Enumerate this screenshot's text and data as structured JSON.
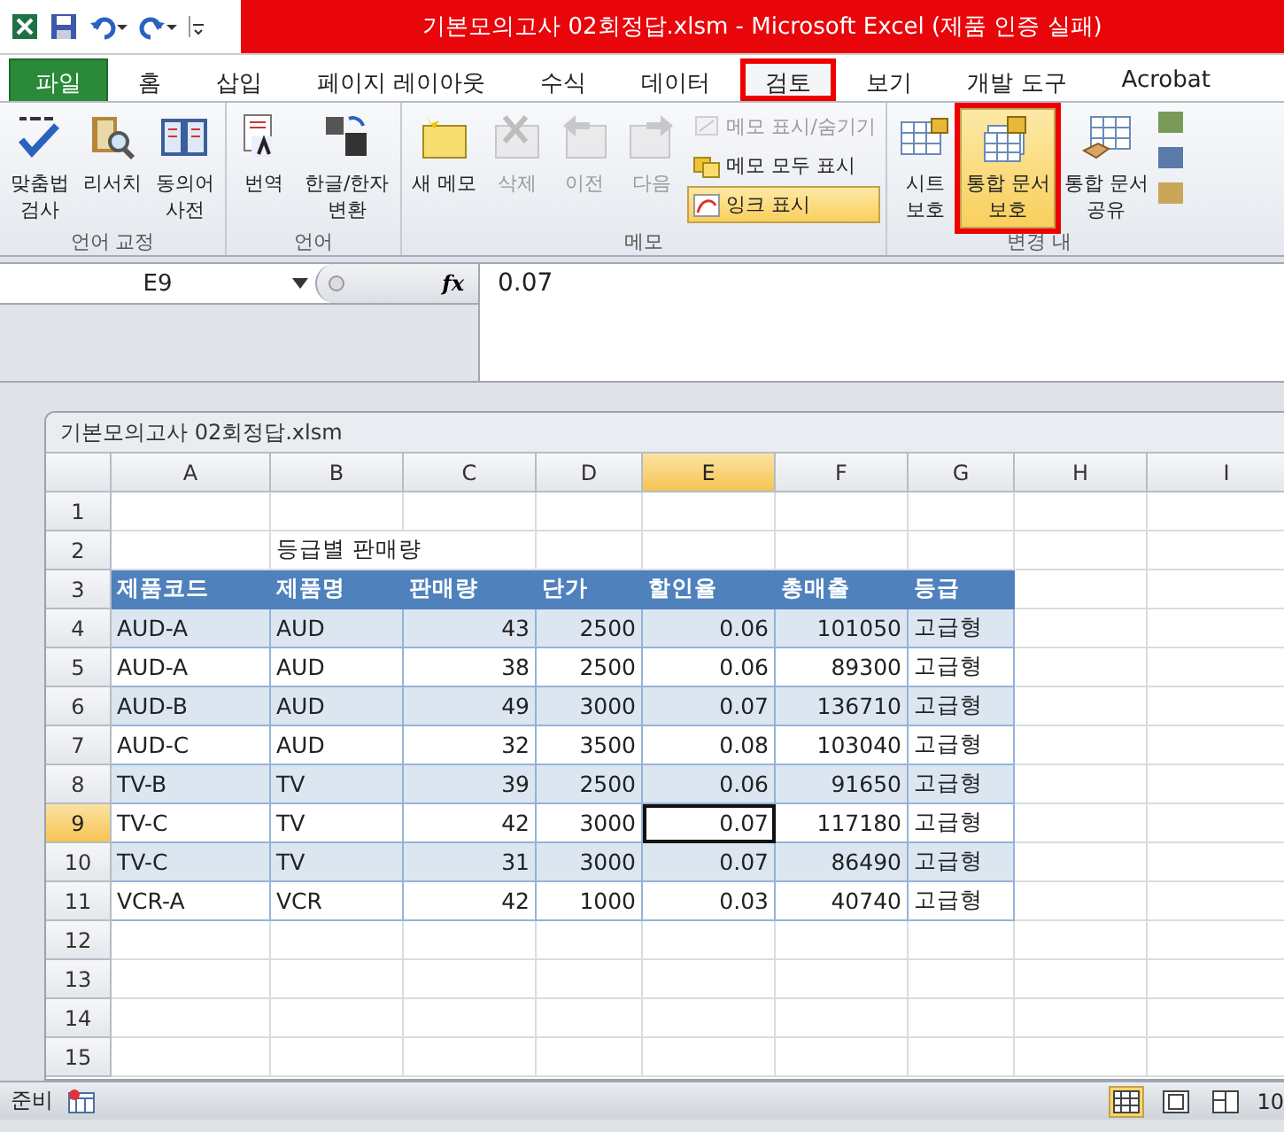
{
  "title_bar": {
    "title": "기본모의고사 02회정답.xlsm  -  Microsoft Excel (제품 인증 실패)"
  },
  "tabs": [
    {
      "label": "파일",
      "kind": "file",
      "selected": false,
      "marked": false
    },
    {
      "label": "홈",
      "kind": "tab",
      "selected": false,
      "marked": false
    },
    {
      "label": "삽입",
      "kind": "tab",
      "selected": false,
      "marked": false
    },
    {
      "label": "페이지 레이아웃",
      "kind": "tab",
      "selected": false,
      "marked": false
    },
    {
      "label": "수식",
      "kind": "tab",
      "selected": false,
      "marked": false
    },
    {
      "label": "데이터",
      "kind": "tab",
      "selected": false,
      "marked": false
    },
    {
      "label": "검토",
      "kind": "tab",
      "selected": true,
      "marked": true
    },
    {
      "label": "보기",
      "kind": "tab",
      "selected": false,
      "marked": false
    },
    {
      "label": "개발 도구",
      "kind": "tab",
      "selected": false,
      "marked": false
    },
    {
      "label": "Acrobat",
      "kind": "tab",
      "selected": false,
      "marked": false
    }
  ],
  "ribbon": {
    "groups": [
      {
        "label": "언어 교정",
        "buttons": [
          {
            "label": "맞춤법\n검사",
            "kind": "large",
            "disabled": false,
            "highlighted": false,
            "marked": false
          },
          {
            "label": "리서치",
            "kind": "large",
            "disabled": false,
            "highlighted": false,
            "marked": false
          },
          {
            "label": "동의어\n사전",
            "kind": "large",
            "disabled": false,
            "highlighted": false,
            "marked": false
          }
        ]
      },
      {
        "label": "언어",
        "buttons": [
          {
            "label": "번역",
            "kind": "large",
            "disabled": false,
            "highlighted": false,
            "marked": false
          },
          {
            "label": "한글/한자\n변환",
            "kind": "large",
            "disabled": false,
            "highlighted": false,
            "marked": false
          }
        ]
      },
      {
        "label": "메모",
        "buttons": [
          {
            "label": "새 메모",
            "kind": "large",
            "disabled": false,
            "highlighted": false,
            "marked": false
          },
          {
            "label": "삭제",
            "kind": "large",
            "disabled": true,
            "highlighted": false,
            "marked": false
          },
          {
            "label": "이전",
            "kind": "large",
            "disabled": true,
            "highlighted": false,
            "marked": false
          },
          {
            "label": "다음",
            "kind": "large",
            "disabled": true,
            "highlighted": false,
            "marked": false
          },
          {
            "label": "메모 표시/숨기기",
            "kind": "small",
            "disabled": true,
            "highlighted": false,
            "marked": false
          },
          {
            "label": "메모 모두 표시",
            "kind": "small",
            "disabled": false,
            "highlighted": false,
            "marked": false
          },
          {
            "label": "잉크 표시",
            "kind": "small",
            "disabled": false,
            "highlighted": true,
            "marked": false
          }
        ]
      },
      {
        "label": "변경 내",
        "buttons": [
          {
            "label": "시트\n보호",
            "kind": "large",
            "disabled": false,
            "highlighted": false,
            "marked": false
          },
          {
            "label": "통합 문서\n보호",
            "kind": "large",
            "disabled": false,
            "highlighted": true,
            "marked": true
          },
          {
            "label": "통합 문서\n공유",
            "kind": "large",
            "disabled": false,
            "highlighted": false,
            "marked": false
          }
        ]
      }
    ]
  },
  "formula_bar": {
    "name_box": "E9",
    "function_label": "fx",
    "value": "0.07"
  },
  "sheet": {
    "title": "기본모의고사 02회정답.xlsm",
    "columns": [
      {
        "label": "A",
        "numeric": false,
        "selected": false
      },
      {
        "label": "B",
        "numeric": false,
        "selected": false
      },
      {
        "label": "C",
        "numeric": true,
        "selected": false
      },
      {
        "label": "D",
        "numeric": true,
        "selected": false
      },
      {
        "label": "E",
        "numeric": true,
        "selected": true
      },
      {
        "label": "F",
        "numeric": true,
        "selected": false
      },
      {
        "label": "G",
        "numeric": false,
        "selected": false
      },
      {
        "label": "H",
        "selected": false
      },
      {
        "label": "I",
        "selected": false
      }
    ],
    "rows": [
      {
        "header": "1",
        "kind": "blank",
        "selected": false
      },
      {
        "header": "2",
        "kind": "title",
        "selected": false,
        "title": "등급별 판매량"
      },
      {
        "header": "3",
        "kind": "header",
        "selected": false,
        "cells": [
          "제품코드",
          "제품명",
          "판매량",
          "단가",
          "할인율",
          "총매출",
          "등급"
        ]
      },
      {
        "header": "4",
        "kind": "band",
        "selected": false,
        "cells": [
          "AUD-A",
          "AUD",
          "43",
          "2500",
          "0.06",
          "101050",
          "고급형"
        ]
      },
      {
        "header": "5",
        "kind": "row",
        "selected": false,
        "cells": [
          "AUD-A",
          "AUD",
          "38",
          "2500",
          "0.06",
          "89300",
          "고급형"
        ]
      },
      {
        "header": "6",
        "kind": "band",
        "selected": false,
        "cells": [
          "AUD-B",
          "AUD",
          "49",
          "3000",
          "0.07",
          "136710",
          "고급형"
        ]
      },
      {
        "header": "7",
        "kind": "row",
        "selected": false,
        "cells": [
          "AUD-C",
          "AUD",
          "32",
          "3500",
          "0.08",
          "103040",
          "고급형"
        ]
      },
      {
        "header": "8",
        "kind": "band",
        "selected": false,
        "cells": [
          "TV-B",
          "TV",
          "39",
          "2500",
          "0.06",
          "91650",
          "고급형"
        ]
      },
      {
        "header": "9",
        "kind": "row",
        "selected": true,
        "cells": [
          "TV-C",
          "TV",
          "42",
          "3000",
          "0.07",
          "117180",
          "고급형"
        ]
      },
      {
        "header": "10",
        "kind": "band",
        "selected": false,
        "cells": [
          "TV-C",
          "TV",
          "31",
          "3000",
          "0.07",
          "86490",
          "고급형"
        ]
      },
      {
        "header": "11",
        "kind": "row",
        "selected": false,
        "cells": [
          "VCR-A",
          "VCR",
          "42",
          "1000",
          "0.03",
          "40740",
          "고급형"
        ]
      },
      {
        "header": "12",
        "kind": "blank",
        "selected": false
      },
      {
        "header": "13",
        "kind": "blank",
        "selected": false
      },
      {
        "header": "14",
        "kind": "blank",
        "selected": false
      },
      {
        "header": "15",
        "kind": "blank",
        "selected": false
      }
    ]
  },
  "status_bar": {
    "status": "준비",
    "views": [
      {
        "selected": true
      },
      {
        "selected": false
      },
      {
        "selected": false
      }
    ],
    "zoom": "10"
  }
}
